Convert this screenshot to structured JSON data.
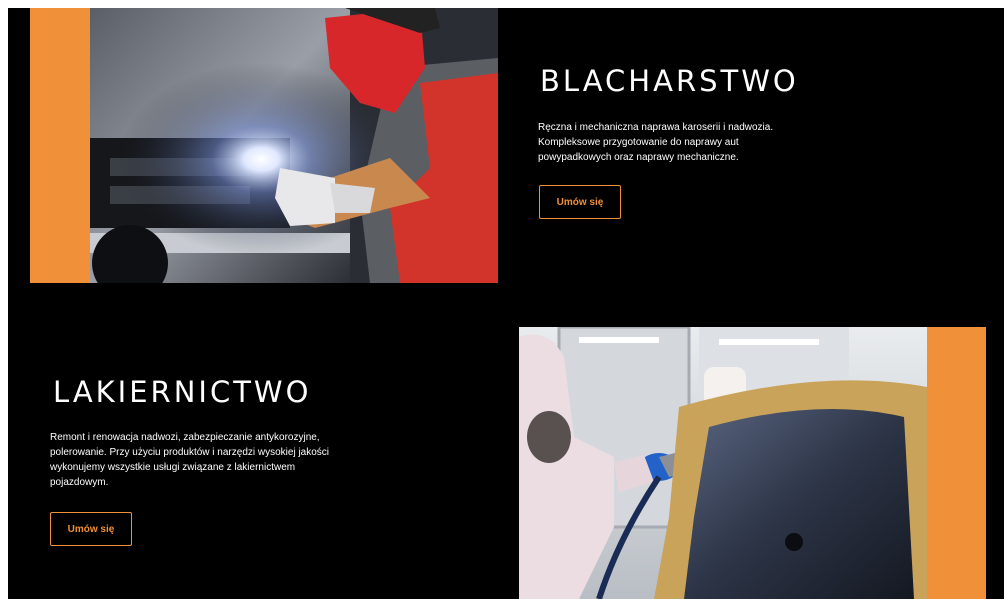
{
  "sections": [
    {
      "title": "BLACHARSTWO",
      "description": "Ręczna i mechaniczna naprawa karoserii i nadwozia. Kompleksowe przygotowanie do naprawy aut powypadkowych oraz naprawy mechaniczne.",
      "button_label": "Umów się",
      "photo": "welding-photo"
    },
    {
      "title": "LAKIERNICTWO",
      "description": "Remont i renowacja nadwozi, zabezpieczanie antykorozyjne, polerowanie. Przy użyciu produktów i narzędzi wysokiej jakości wykonujemy wszystkie usługi związane z lakiernictwem pojazdowym.",
      "button_label": "Umów się",
      "photo": "spray-painting-photo"
    }
  ],
  "colors": {
    "background": "#000000",
    "accent": "#f0913a",
    "text": "#ffffff"
  }
}
